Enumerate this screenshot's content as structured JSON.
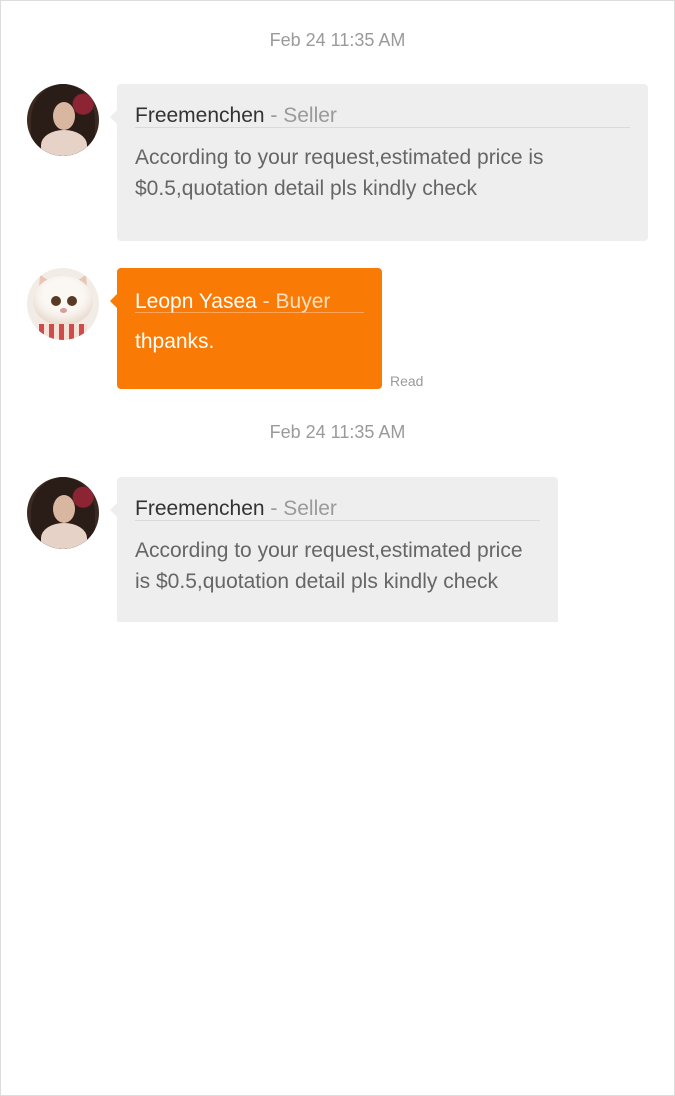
{
  "messages": [
    {
      "timestamp": "Feb 24 11:35 AM",
      "sender": "Freemenchen",
      "role": " - Seller",
      "text": "According to your request,estimated price is $0.5,quotation detail pls kindly check"
    },
    {
      "sender": "Leopn Yasea",
      "role": " - Buyer",
      "text": "thpanks.",
      "status": "Read"
    },
    {
      "timestamp": "Feb 24 11:35 AM",
      "sender": "Freemenchen",
      "role": " - Seller",
      "text": "According to your request,estimated price is $0.5,quotation detail pls kindly check"
    }
  ],
  "colors": {
    "seller_bubble": "#eeeeee",
    "buyer_bubble": "#f97a05",
    "muted_text": "#9a9a9a"
  }
}
